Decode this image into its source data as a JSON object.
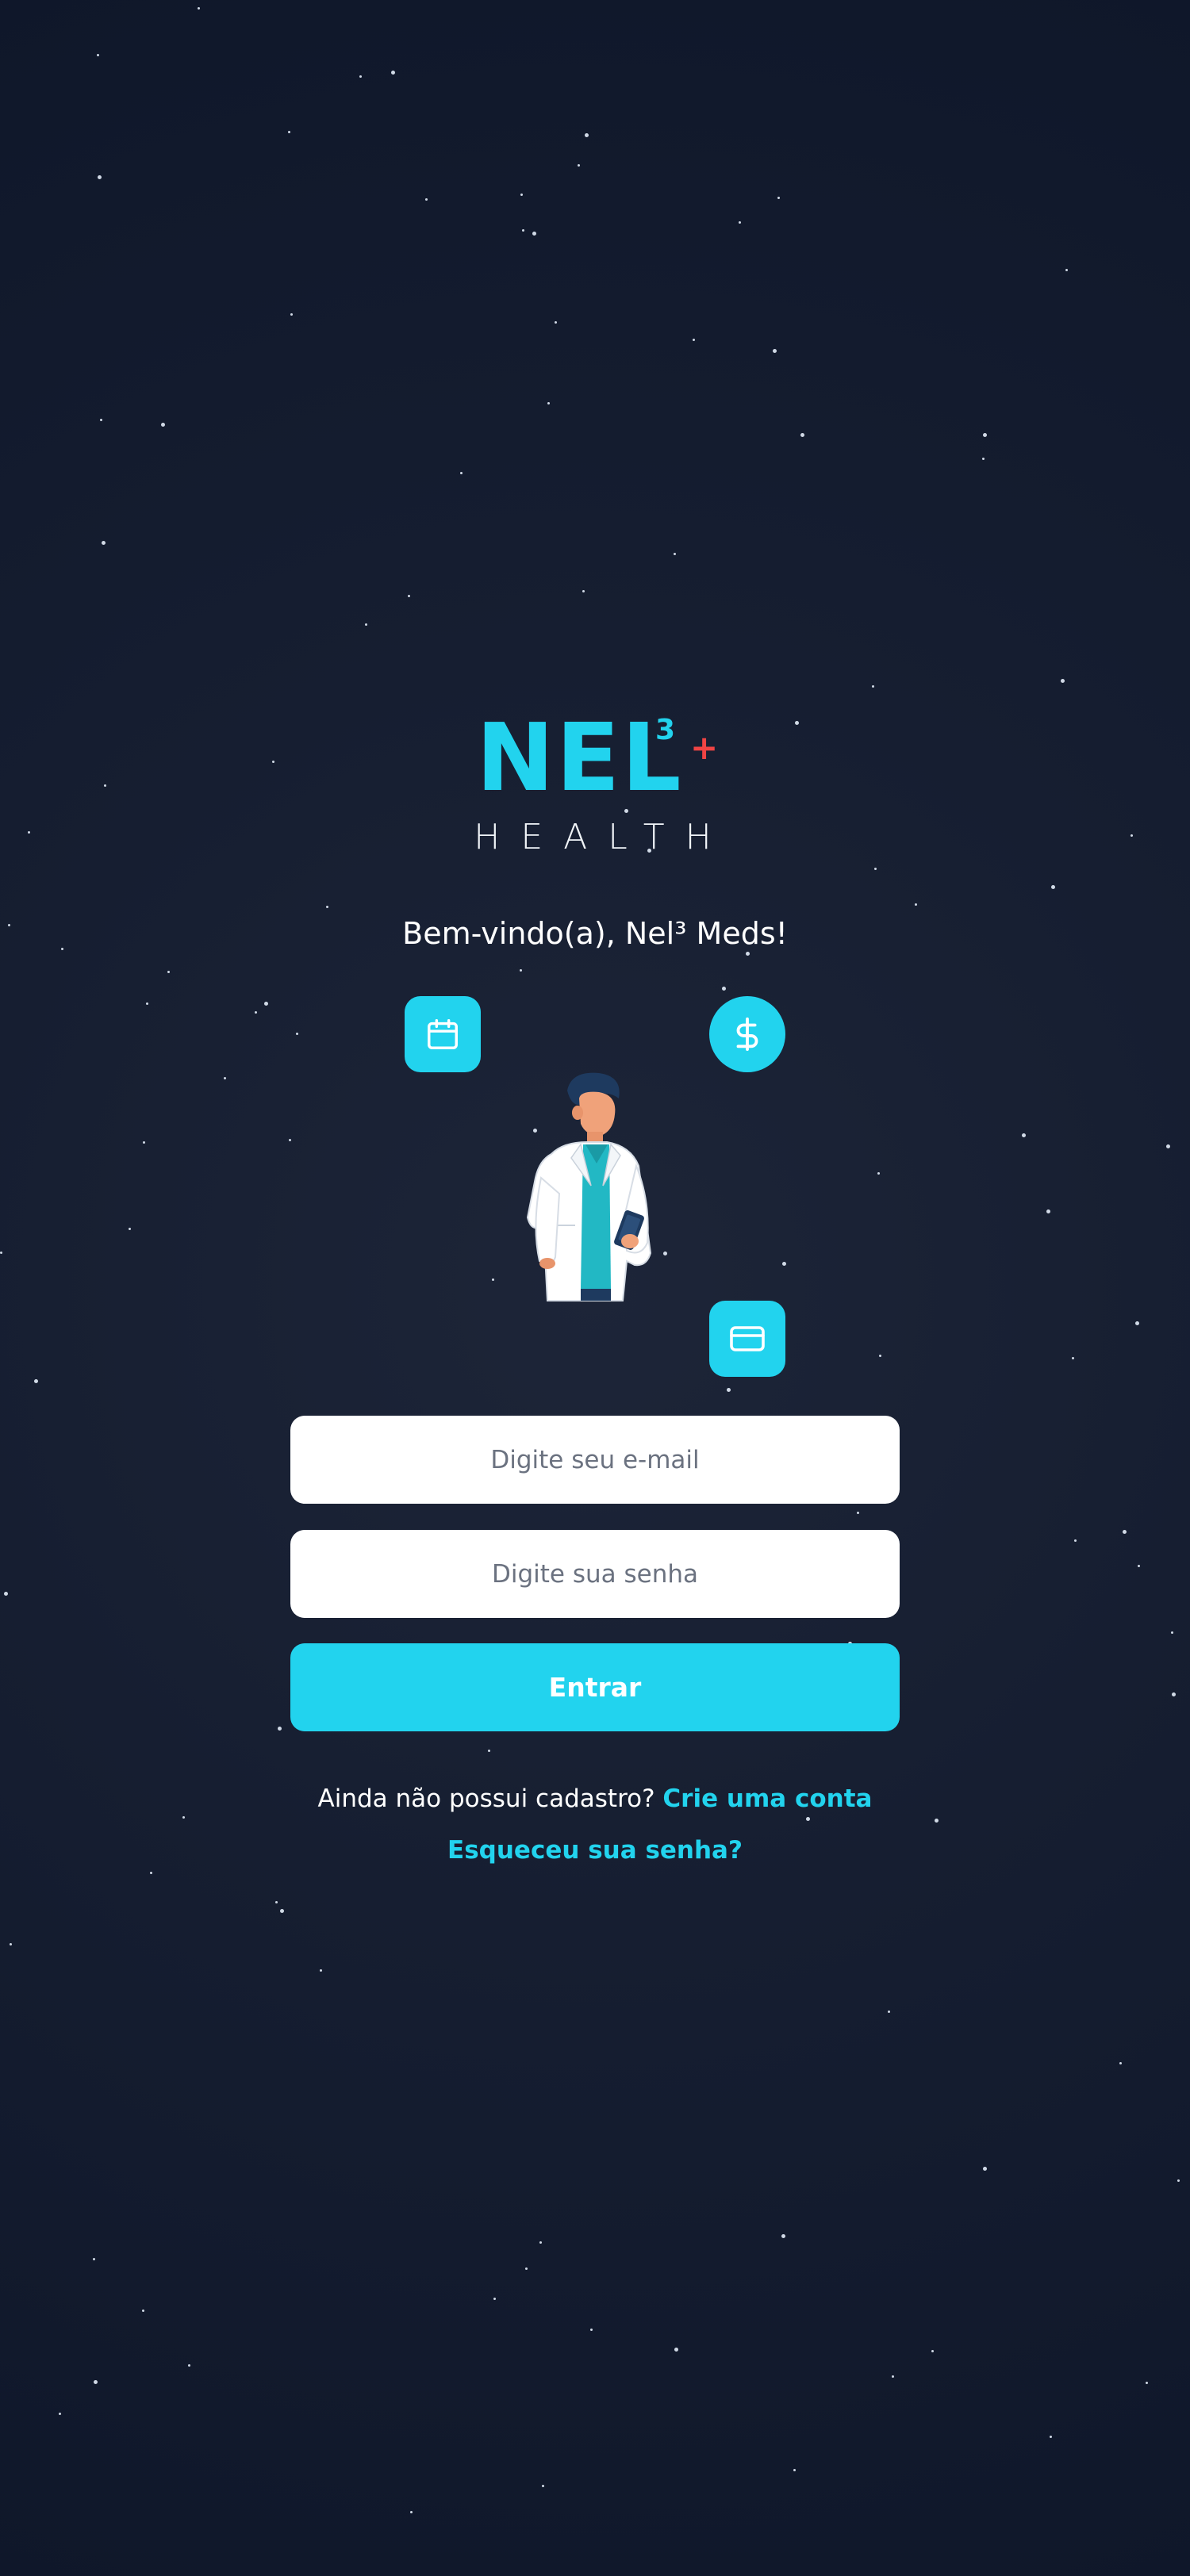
{
  "logo": {
    "brand": "NEL",
    "superscript": "3",
    "plus": "+",
    "subtitle": "HEALTH"
  },
  "welcome_text": "Bem-vindo(a), Nel³ Meds!",
  "feature_icons": [
    "calendar-icon",
    "dollar-icon",
    "credit-card-icon"
  ],
  "illustration": "doctor-with-phone",
  "form": {
    "email_placeholder": "Digite seu e-mail",
    "password_placeholder": "Digite sua senha",
    "submit_label": "Entrar"
  },
  "signup": {
    "prompt": "Ainda não possui cadastro?",
    "link_label": "Crie uma conta"
  },
  "forgot_password_label": "Esqueceu sua senha?",
  "colors": {
    "accent": "#22d3ee",
    "plus": "#ef4444",
    "background": "#0f172a",
    "text": "#ffffff"
  }
}
